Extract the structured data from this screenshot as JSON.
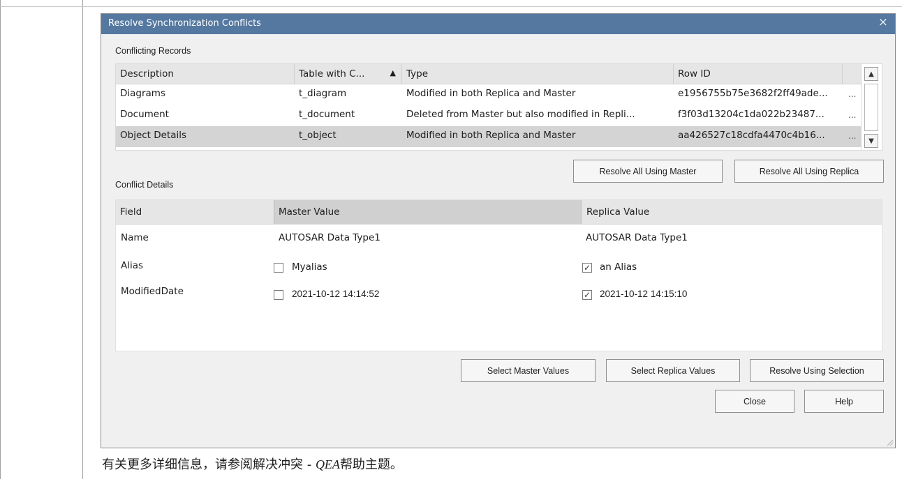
{
  "dialog": {
    "title": "Resolve Synchronization Conflicts",
    "close_glyph": "×",
    "conflicting_records_label": "Conflicting Records",
    "conflict_details_label": "Conflict Details"
  },
  "records": {
    "columns": [
      "Description",
      "Table with C...",
      "Type",
      "Row ID"
    ],
    "sort_indicator": "▲",
    "rows": [
      {
        "description": "Diagrams",
        "table": "t_diagram",
        "type": "Modified in both Replica and Master",
        "row_id": "e1956755b75e3682f2ff49ade...",
        "more": "..."
      },
      {
        "description": "Document",
        "table": "t_document",
        "type": "Deleted from Master but also modified in Repli...",
        "row_id": "f3f03d13204c1da022b23487...",
        "more": "..."
      },
      {
        "description": "Object Details",
        "table": "t_object",
        "type": "Modified in both Replica and Master",
        "row_id": "aa426527c18cdfa4470c4b16...",
        "more": "...",
        "selected": true
      }
    ]
  },
  "buttons": {
    "resolve_master": "Resolve All Using Master",
    "resolve_replica": "Resolve All Using Replica",
    "select_master": "Select Master Values",
    "select_replica": "Select Replica Values",
    "resolve_selection": "Resolve Using Selection",
    "close": "Close",
    "help": "Help"
  },
  "details": {
    "columns": [
      "Field",
      "Master Value",
      "Replica Value"
    ],
    "rows": [
      {
        "field": "Name",
        "master_prefix": "AUTOSAR",
        "master_rest": " Data Type1",
        "replica_prefix": "AUTOSAR",
        "replica_rest": " Data Type1"
      },
      {
        "field": "Alias",
        "master": "Myalias",
        "master_checked": false,
        "replica": "an Alias",
        "replica_checked": true
      },
      {
        "field": "ModifiedDate",
        "master": "2021-10-12 14:14:52",
        "master_checked": false,
        "replica": "2021-10-12 14:15:10",
        "replica_checked": true
      }
    ]
  },
  "footer_text": {
    "before": "有关更多详细信息，请参阅解决冲突 - ",
    "emph": "QEA",
    "after": "帮助主题。"
  },
  "colors": {
    "titlebar": "#5478a0",
    "dialog_bg": "#f0f0f0",
    "selected_row": "#d4d4d4"
  }
}
